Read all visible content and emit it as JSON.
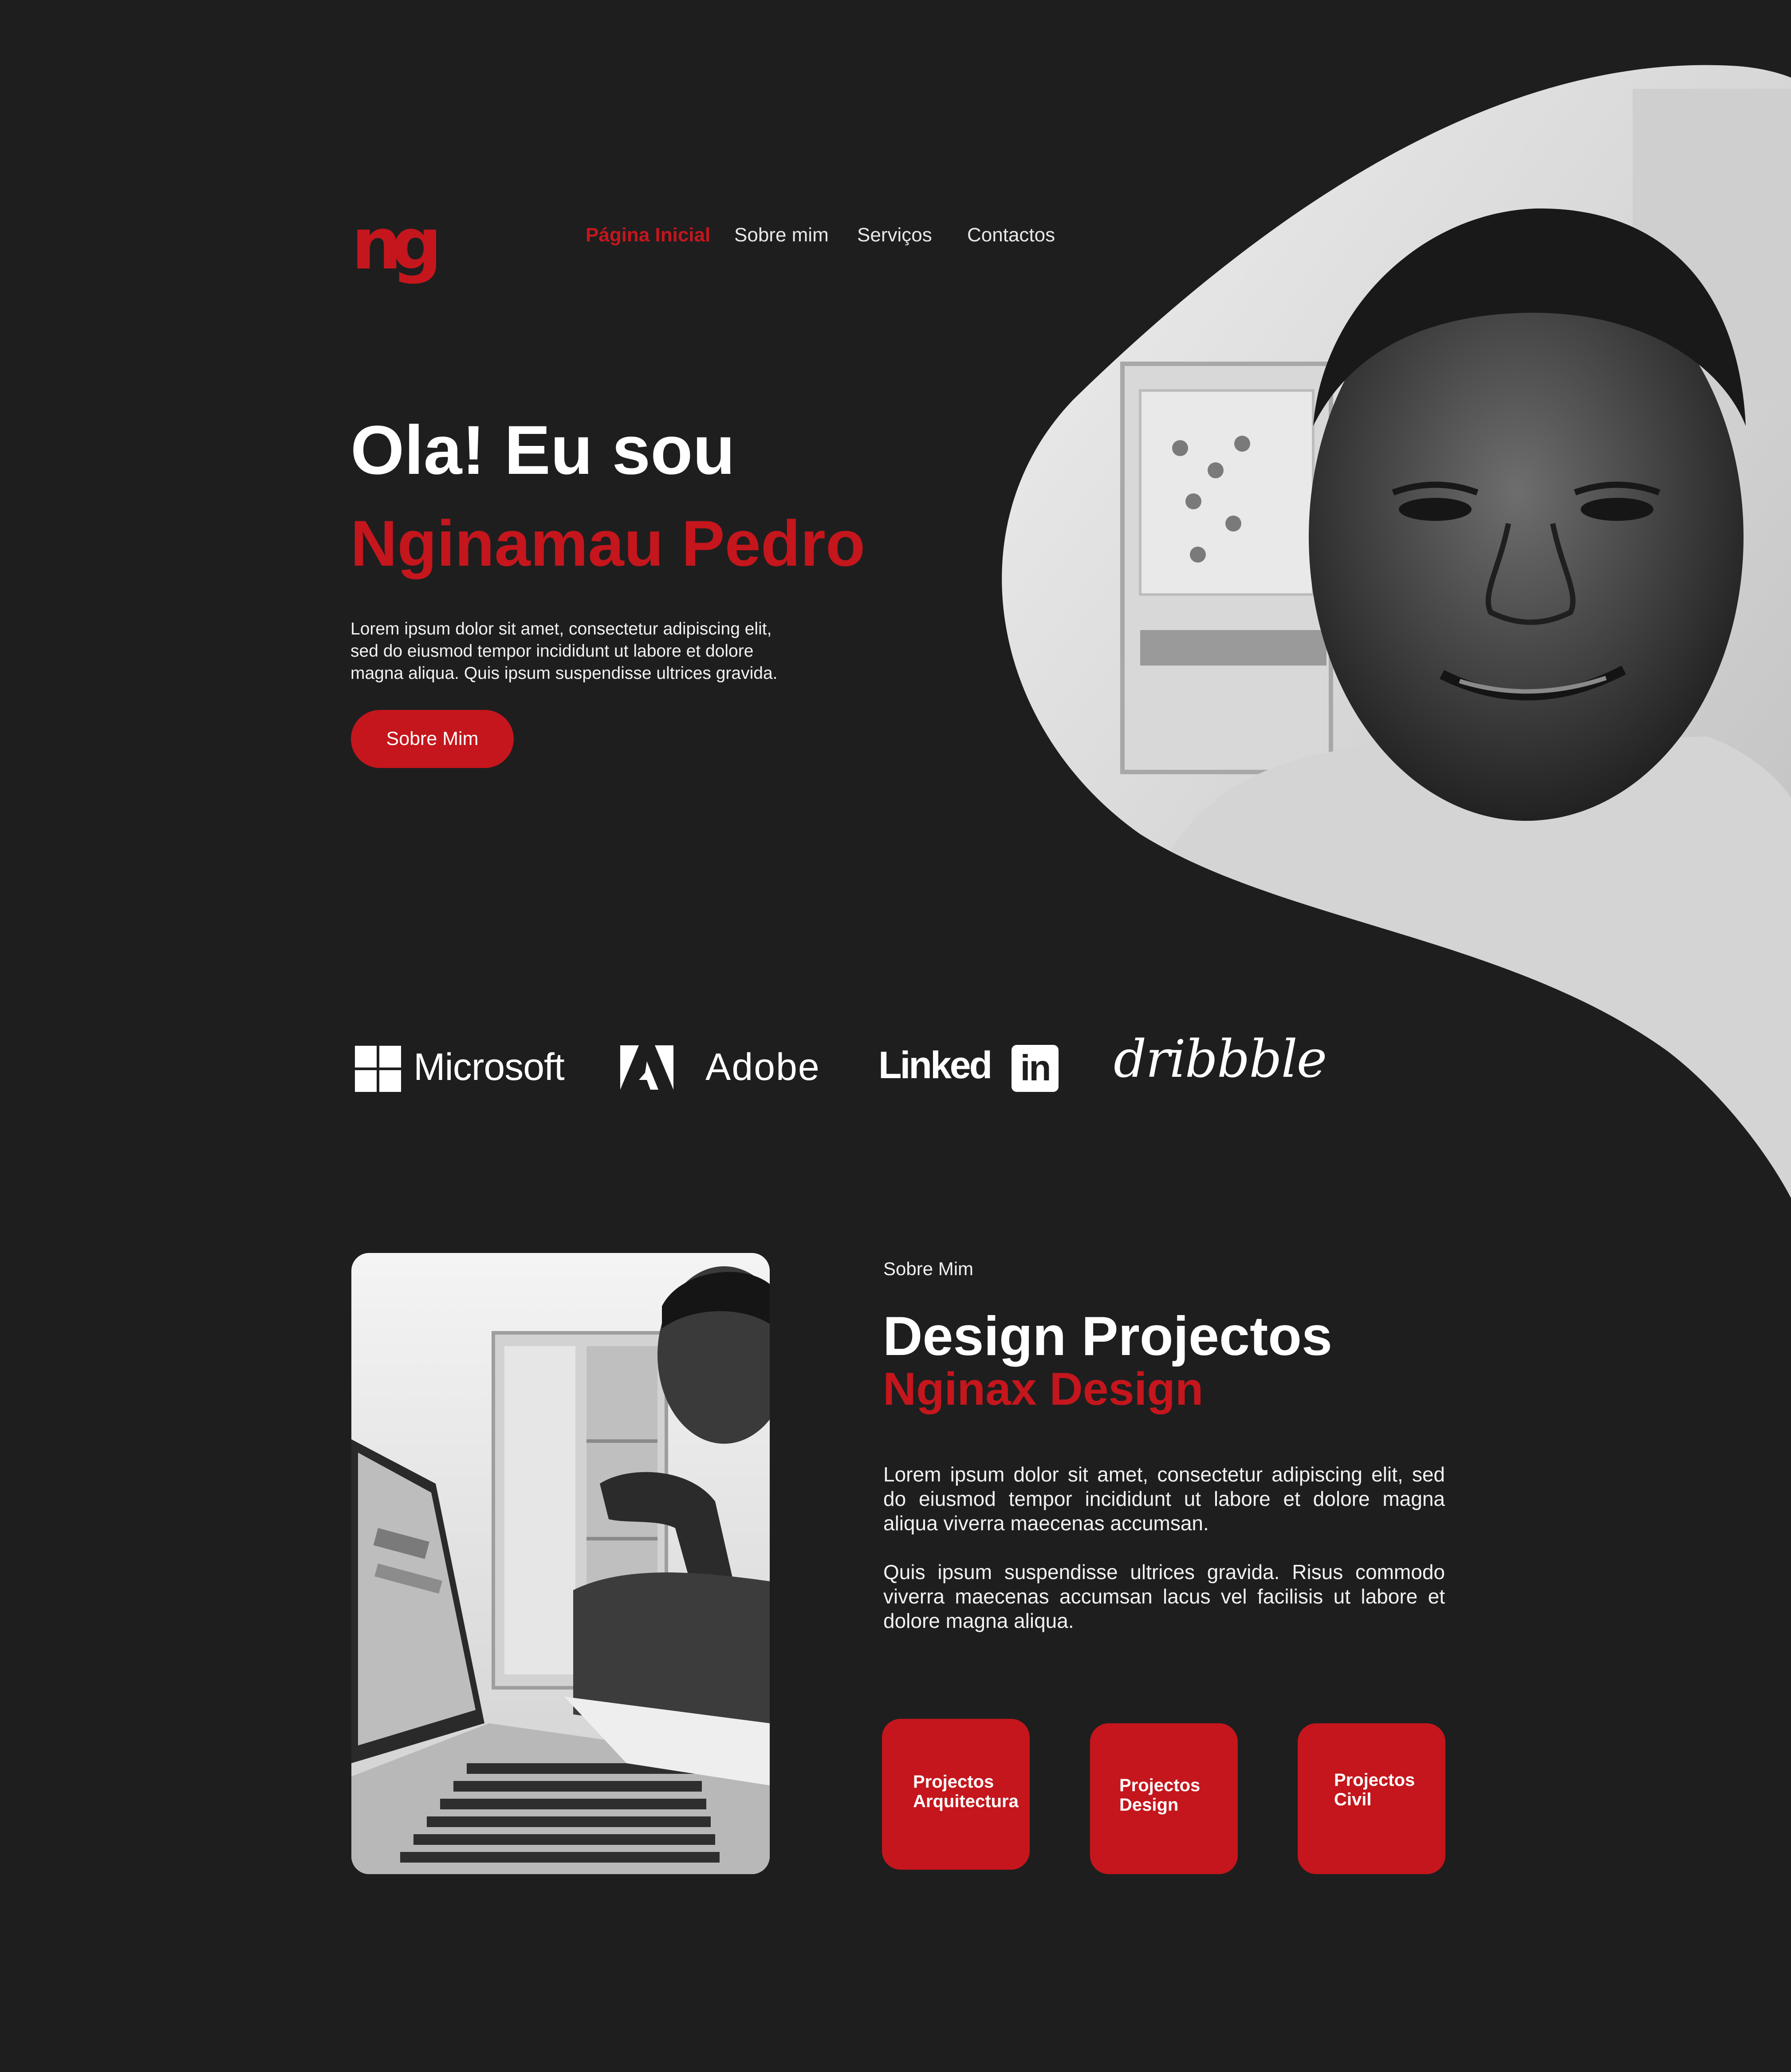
{
  "logo": {
    "text": "ng"
  },
  "nav": {
    "items": [
      {
        "label": "Página Inicial",
        "active": true
      },
      {
        "label": "Sobre mim",
        "active": false
      },
      {
        "label": "Serviços",
        "active": false
      },
      {
        "label": "Contactos",
        "active": false
      }
    ]
  },
  "hero": {
    "greeting": "Ola! Eu sou",
    "name": "Nginamau Pedro",
    "description": "Lorem ipsum dolor sit amet, consectetur adipiscing elit, sed do eiusmod tempor incididunt ut labore et dolore magna aliqua. Quis ipsum suspendisse ultrices gravida.",
    "button_label": "Sobre Mim",
    "photo_icon": "portrait-photo"
  },
  "brands": [
    {
      "name": "Microsoft",
      "icon": "microsoft-logo-icon"
    },
    {
      "name": "Adobe",
      "icon": "adobe-logo-icon"
    },
    {
      "name": "Linked",
      "badge": "in",
      "icon": "linkedin-logo-icon"
    },
    {
      "name": "dribbble",
      "icon": "dribbble-logo-icon"
    }
  ],
  "about": {
    "eyebrow": "Sobre Mim",
    "title": "Design Projectos",
    "subtitle": "Nginax Design",
    "paragraph_1": "Lorem ipsum dolor sit amet, consectetur adipiscing elit, sed do eiusmod tempor incididunt ut labore et dolore magna aliqua viverra maecenas accumsan.",
    "paragraph_2": "Quis ipsum suspendisse ultrices gravida. Risus commodo viverra maecenas accumsan lacus vel facilisis ut labore et dolore magna aliqua.",
    "photo_icon": "laptop-work-photo"
  },
  "projects": [
    {
      "label": "Projectos\nArquitectura"
    },
    {
      "label": "Projectos\nDesign"
    },
    {
      "label": "Projectos\nCivil"
    }
  ],
  "colors": {
    "background": "#1e1e1f",
    "accent": "#c4161c",
    "text": "#ffffff"
  }
}
